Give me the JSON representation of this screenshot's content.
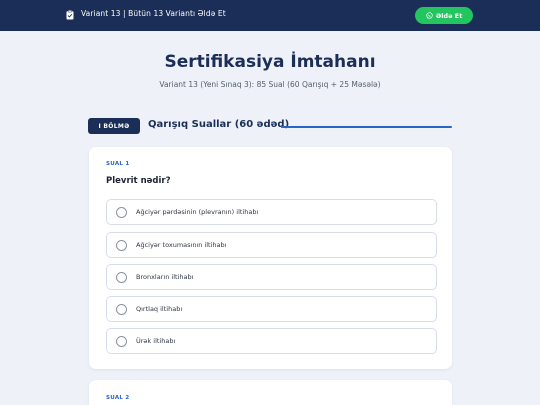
{
  "topbar": {
    "title": "Variant 13 | Bütün 13 Variantı Əldə Et",
    "whatsapp_label": "Əldə Et",
    "accent": "#22c55e",
    "background": "#1b2e57"
  },
  "header": {
    "title": "Sertifikasiya İmtahanı",
    "subtitle": "Variant 13 (Yeni Sınaq 3): 85 Sual (60 Qarışıq + 25 Məsələ)"
  },
  "section": {
    "badge": "I BÖLMƏ",
    "title": "Qarışıq Suallar (60 ədəd)"
  },
  "questions": [
    {
      "number_label": "SUAL 1",
      "text": "Plevrit nədir?",
      "options": [
        "Ağciyər pərdəsinin (plevranın) iltihabı",
        "Ağciyər toxumasının iltihabı",
        "Bronxların iltihabı",
        "Qırtlaq iltihabı",
        "Ürək iltihabı"
      ]
    },
    {
      "number_label": "SUAL 2"
    }
  ],
  "icons": {
    "topbar_doc": "clipboard-icon",
    "whatsapp": "whatsapp-icon",
    "option_radio": "radio-icon"
  }
}
